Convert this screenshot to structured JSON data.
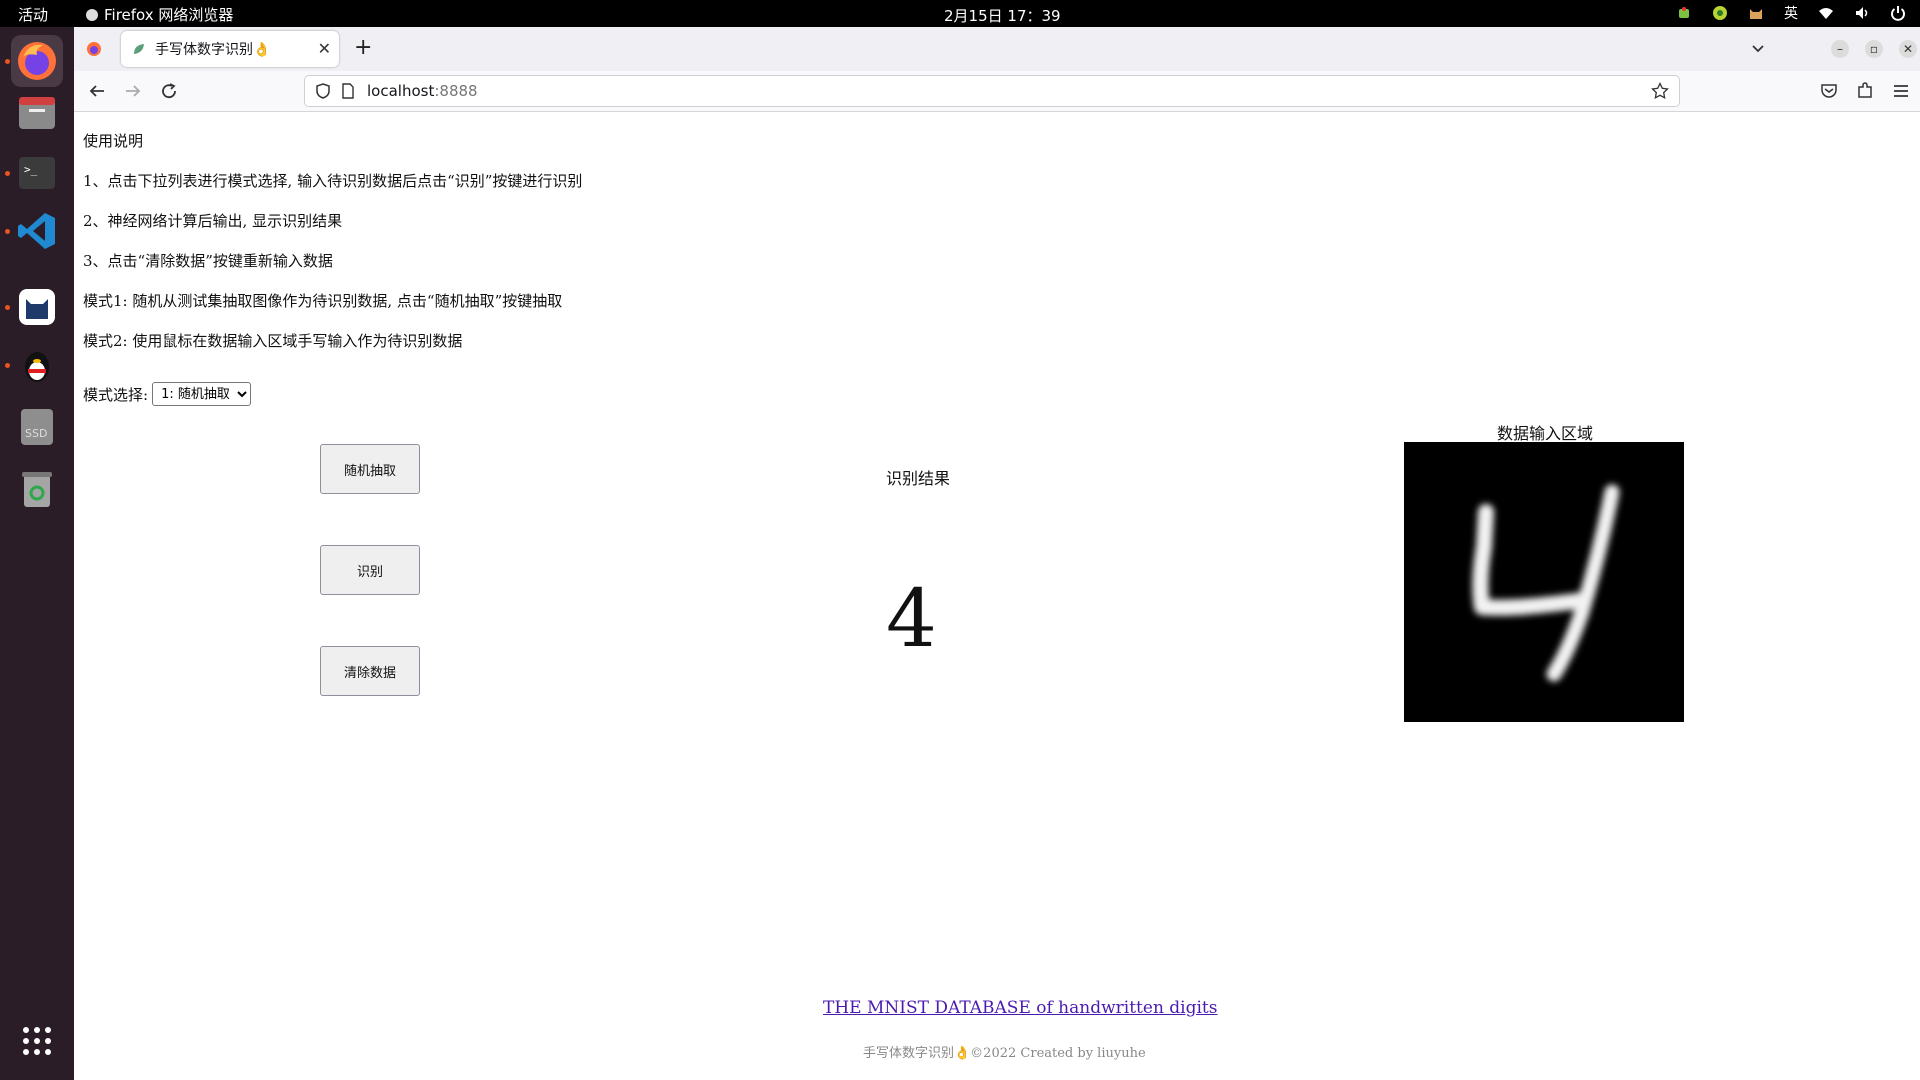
{
  "topbar": {
    "activities": "活动",
    "app_name": "Firefox 网络浏览器",
    "clock": "2月15日  17：39",
    "input_method": "英"
  },
  "dock": {
    "items": [
      "firefox-icon",
      "files-icon",
      "terminal-icon",
      "vscode-icon",
      "cat-app-icon",
      "qq-penguin-icon",
      "ssd-drive-icon",
      "trash-icon",
      "app-grid-icon"
    ]
  },
  "browser": {
    "tab_title": "手写体数字识别👌",
    "url_host": "localhost",
    "url_port": ":8888"
  },
  "page": {
    "instructions": [
      "使用说明",
      "1、点击下拉列表进行模式选择, 输入待识别数据后点击“识别”按键进行识别",
      "2、神经网络计算后输出, 显示识别结果",
      "3、点击“清除数据”按键重新输入数据",
      "模式1: 随机从测试集抽取图像作为待识别数据, 点击“随机抽取”按键抽取",
      "模式2: 使用鼠标在数据输入区域手写输入作为待识别数据"
    ],
    "mode_label": "模式选择:",
    "mode_selected": "1: 随机抽取",
    "buttons": {
      "random": "随机抽取",
      "recognize": "识别",
      "clear": "清除数据"
    },
    "result_title": "识别结果",
    "result_value": "4",
    "canvas_title": "数据输入区域",
    "link": "THE MNIST DATABASE of handwritten digits",
    "footer": "手写体数字识别👌©2022 Created by liuyuhe"
  },
  "colors": {
    "dock_bg": "#2b1d27",
    "link": "#4b1bb0",
    "accent_dot": "#e95420"
  }
}
